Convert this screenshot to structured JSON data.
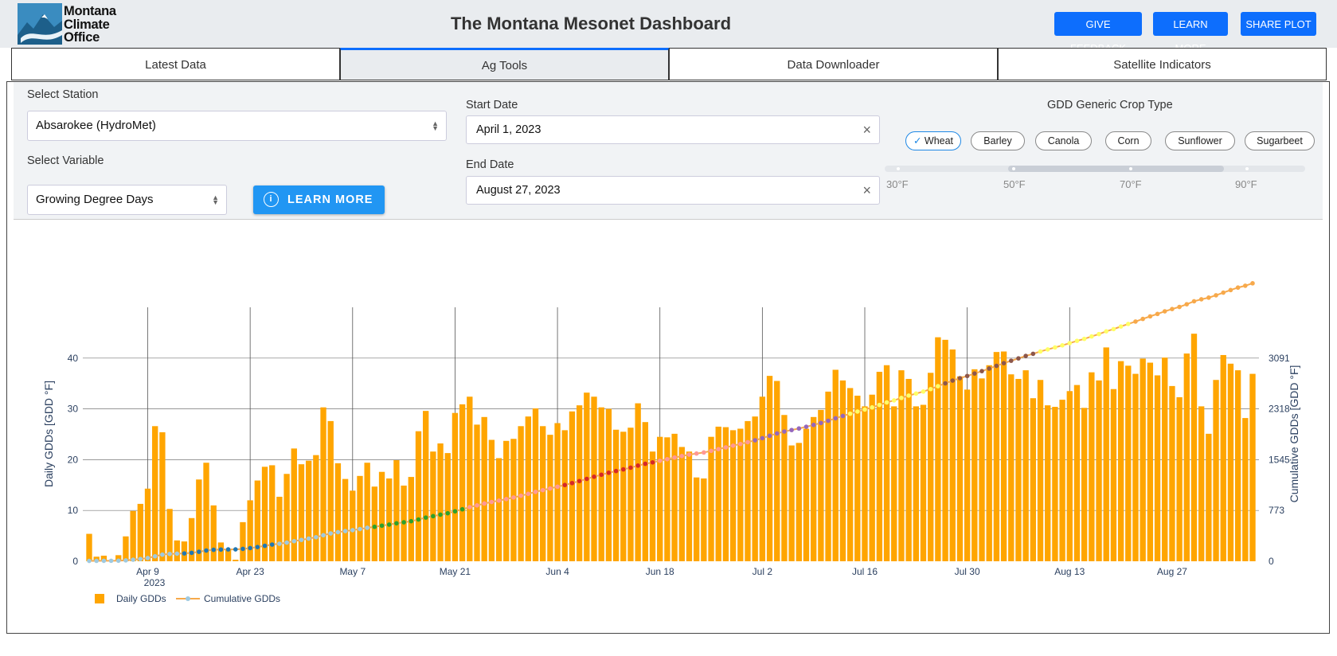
{
  "header": {
    "logo_lines": [
      "Montana",
      "Climate",
      "Office"
    ],
    "title": "The Montana Mesonet Dashboard",
    "buttons": [
      "GIVE FEEDBACK",
      "LEARN MORE",
      "SHARE PLOT"
    ]
  },
  "tabs": [
    {
      "label": "Latest Data",
      "active": false
    },
    {
      "label": "Ag Tools",
      "active": true
    },
    {
      "label": "Data Downloader",
      "active": false
    },
    {
      "label": "Satellite Indicators",
      "active": false
    }
  ],
  "controls": {
    "station_label": "Select Station",
    "station_value": "Absarokee (HydroMet)",
    "variable_label": "Select Variable",
    "variable_value": "Growing Degree Days",
    "learn_more": "LEARN MORE",
    "start_label": "Start Date",
    "start_value": "April 1, 2023",
    "end_label": "End Date",
    "end_value": "August 27, 2023",
    "crop_label": "GDD Generic Crop Type",
    "crops": [
      "Wheat",
      "Barley",
      "Canola",
      "Corn",
      "Sunflower",
      "Sugarbeet"
    ],
    "crop_selected": "Wheat",
    "temp_labels": [
      "30°F",
      "50°F",
      "70°F",
      "90°F"
    ],
    "temp_range_f": [
      50,
      86
    ]
  },
  "colors": {
    "accent": "#0d6efd",
    "bar": "#FFA500",
    "cumulative_line": "#f7a94b"
  },
  "chart_data": {
    "type": "bar",
    "x_start": "2023-04-01",
    "x_end": "2023-08-27",
    "x_ticks": [
      "Apr 9",
      "Apr 23",
      "May 7",
      "May 21",
      "Jun 4",
      "Jun 18",
      "Jul 2",
      "Jul 16",
      "Jul 30",
      "Aug 13",
      "Aug 27"
    ],
    "x_year_label": "2023",
    "ylabel": "Daily GDDs [GDD °F]",
    "y2label": "Cumulative GDDs [GDD °F]",
    "ylim": [
      0,
      50
    ],
    "y_ticks": [
      0,
      10,
      20,
      30,
      40
    ],
    "y2lim": [
      0,
      3863
    ],
    "y2_ticks": [
      0,
      773,
      1545,
      2318,
      3091
    ],
    "legend": [
      "Daily GDDs",
      "Cumulative GDDs"
    ],
    "legend_position": "bottom-left",
    "series": [
      {
        "name": "Daily GDDs",
        "type": "bar",
        "values": [
          5.4,
          0.9,
          1.1,
          0.2,
          1.2,
          4.9,
          9.9,
          11.3,
          14.3,
          26.6,
          25.4,
          10.3,
          4.1,
          3.9,
          8.5,
          16.1,
          19.4,
          11.0,
          3.7,
          2.2,
          0.3,
          7.7,
          12.0,
          15.9,
          18.6,
          18.9,
          12.7,
          17.2,
          22.2,
          19.1,
          19.8,
          20.9,
          30.3,
          27.6,
          19.3,
          16.2,
          13.9,
          16.8,
          19.4,
          14.7,
          17.6,
          16.3,
          19.9,
          14.9,
          16.6,
          25.6,
          29.6,
          21.6,
          23.2,
          21.3,
          29.2,
          30.9,
          32.4,
          26.9,
          28.4,
          23.9,
          20.3,
          23.7,
          24.1,
          26.6,
          28.5,
          30.1,
          26.6,
          24.9,
          27.2,
          25.8,
          29.5,
          30.7,
          33.2,
          32.4,
          30.3,
          30.0,
          25.9,
          25.5,
          26.3,
          31.1,
          27.4,
          21.6,
          24.5,
          24.4,
          25.1,
          22.5,
          21.6,
          16.5,
          16.3,
          24.5,
          26.5,
          26.4,
          25.8,
          26.1,
          27.6,
          28.5,
          32.4,
          36.5,
          35.5,
          28.8,
          22.8,
          23.3,
          26.1,
          28.4,
          29.8,
          33.4,
          37.7,
          35.6,
          34.1,
          32.6,
          30.5,
          32.8,
          37.3,
          38.6,
          30.5,
          37.6,
          35.9,
          30.5,
          30.8,
          37.1,
          44.1,
          43.6,
          41.7,
          36.4,
          33.8,
          37.8,
          36.0,
          38.6,
          41.2,
          41.3,
          36.8,
          35.9,
          37.6,
          32.1,
          35.7,
          30.7,
          30.4,
          31.8,
          33.5,
          34.7,
          30.2,
          37.2,
          35.6,
          42.1,
          33.9,
          39.4,
          38.5,
          36.9,
          39.9,
          39.1,
          36.6,
          40.1,
          34.5,
          32.3,
          40.9,
          44.8,
          30.5,
          25.1,
          35.7,
          40.6,
          38.9,
          37.6,
          28.2,
          36.9
        ]
      },
      {
        "name": "Cumulative GDDs",
        "type": "line",
        "cumulative_of": "Daily GDDs"
      }
    ],
    "cumulative_marker_colors": [
      "#9ecae1",
      "#1f77b4",
      "#9ecae1",
      "#2ca02c",
      "#ff9896",
      "#d62728",
      "#ff9896",
      "#9467bd",
      "#ffff66",
      "#8c564b",
      "#ffff66",
      "#f7a94b"
    ]
  }
}
